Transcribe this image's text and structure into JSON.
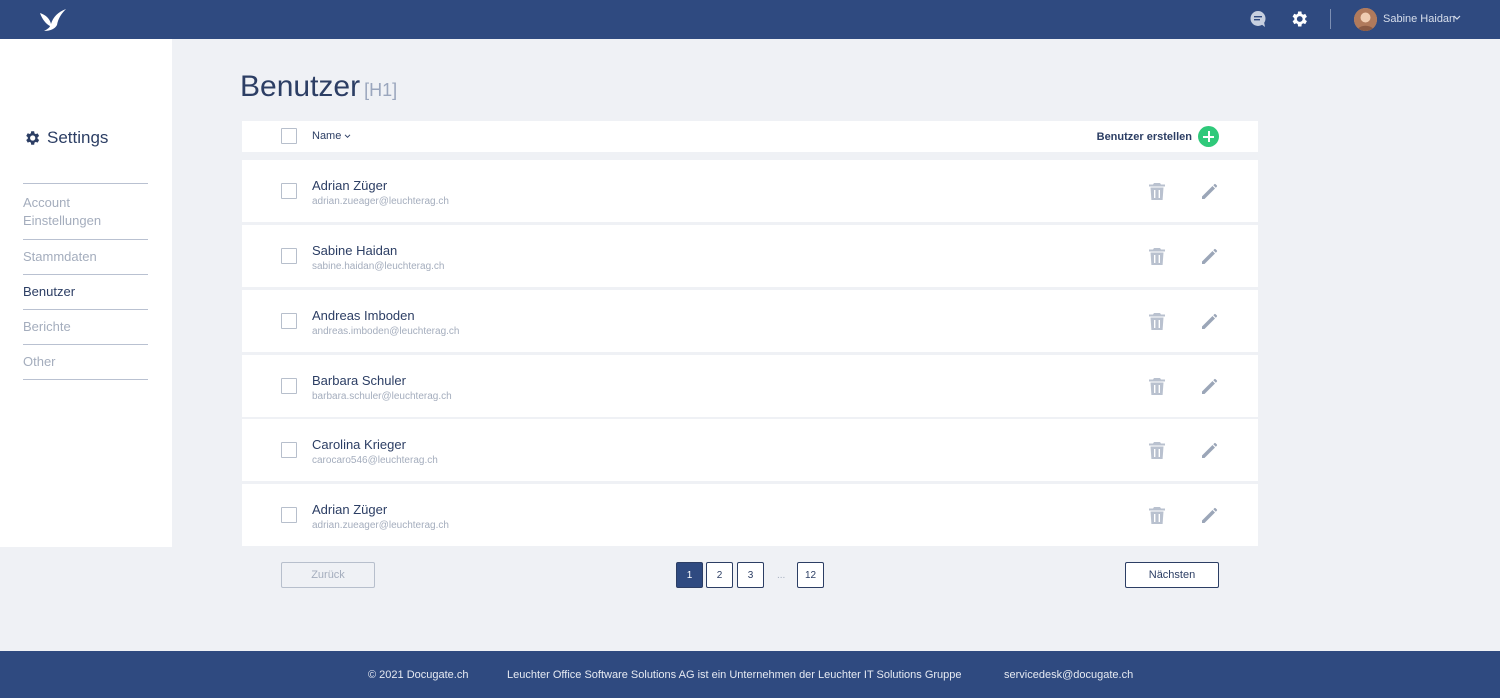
{
  "topbar": {
    "user_name": "Sabine Haidan"
  },
  "sidebar": {
    "title": "Settings",
    "items": [
      {
        "label": "Account Einstellungen",
        "active": false
      },
      {
        "label": "Stammdaten",
        "active": false
      },
      {
        "label": "Benutzer",
        "active": true
      },
      {
        "label": "Berichte",
        "active": false
      },
      {
        "label": "Other",
        "active": false
      }
    ]
  },
  "main": {
    "title": "Benutzer",
    "title_tag": "[H1]",
    "header": {
      "name_label": "Name",
      "create_label": "Benutzer erstellen"
    },
    "rows": [
      {
        "name": "Adrian Züger",
        "email": "adrian.zueager@leuchterag.ch"
      },
      {
        "name": "Sabine Haidan",
        "email": "sabine.haidan@leuchterag.ch"
      },
      {
        "name": "Andreas Imboden",
        "email": "andreas.imboden@leuchterag.ch"
      },
      {
        "name": "Barbara Schuler",
        "email": "barbara.schuler@leuchterag.ch"
      },
      {
        "name": "Carolina Krieger",
        "email": "carocaro546@leuchterag.ch"
      },
      {
        "name": "Adrian Züger",
        "email": "adrian.zueager@leuchterag.ch"
      }
    ]
  },
  "pagination": {
    "back_label": "Zurück",
    "next_label": "Nächsten",
    "pages": [
      "1",
      "2",
      "3",
      "12"
    ],
    "ellipsis": "...",
    "current": "1"
  },
  "footer": {
    "copyright": "© 2021 Docugate.ch",
    "company": "Leuchter Office Software Solutions AG ist ein Unternehmen der Leuchter IT Solutions Gruppe",
    "email": "servicedesk@docugate.ch"
  },
  "colors": {
    "brand": "#2f4a80",
    "accent_green": "#2fc97a",
    "text_dark": "#2c3e64",
    "text_muted": "#a4adbd"
  },
  "icons": [
    "bird-logo-icon",
    "chat-icon",
    "gear-icon",
    "chevron-down-icon",
    "trash-icon",
    "pencil-icon",
    "plus-icon"
  ]
}
